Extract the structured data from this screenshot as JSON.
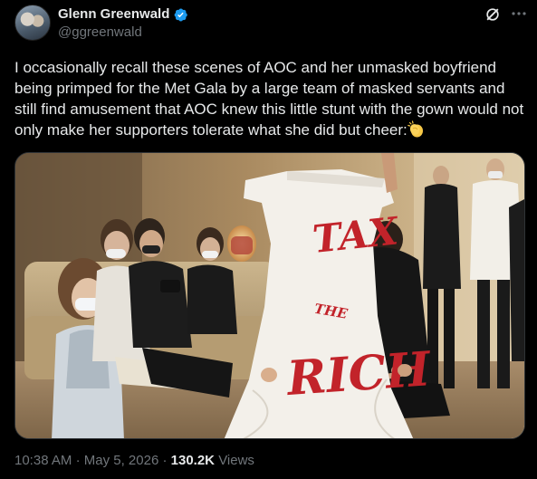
{
  "author": {
    "display_name": "Glenn Greenwald",
    "handle": "@ggreenwald",
    "verified": true,
    "verified_color": "#1d9bf0"
  },
  "header_actions": {
    "grok_icon": "grok-icon",
    "more_icon": "more-icon"
  },
  "tweet": {
    "text": "I occasionally recall these scenes of AOC and her unmasked boyfriend being primped for the Met Gala by a large team of masked servants and still find amusement that AOC knew this little stunt with the gown would not only make her supporters tolerate what she did but cheer:",
    "trailing_emoji": "clapping-hands-emoji"
  },
  "media": {
    "dress_text_top": "TAX",
    "dress_text_mid": "THE",
    "dress_text_bottom": "RICH"
  },
  "meta": {
    "time": "10:38 AM",
    "separator": "·",
    "date": "May 5, 2026",
    "views_count": "130.2K",
    "views_label": "Views"
  }
}
